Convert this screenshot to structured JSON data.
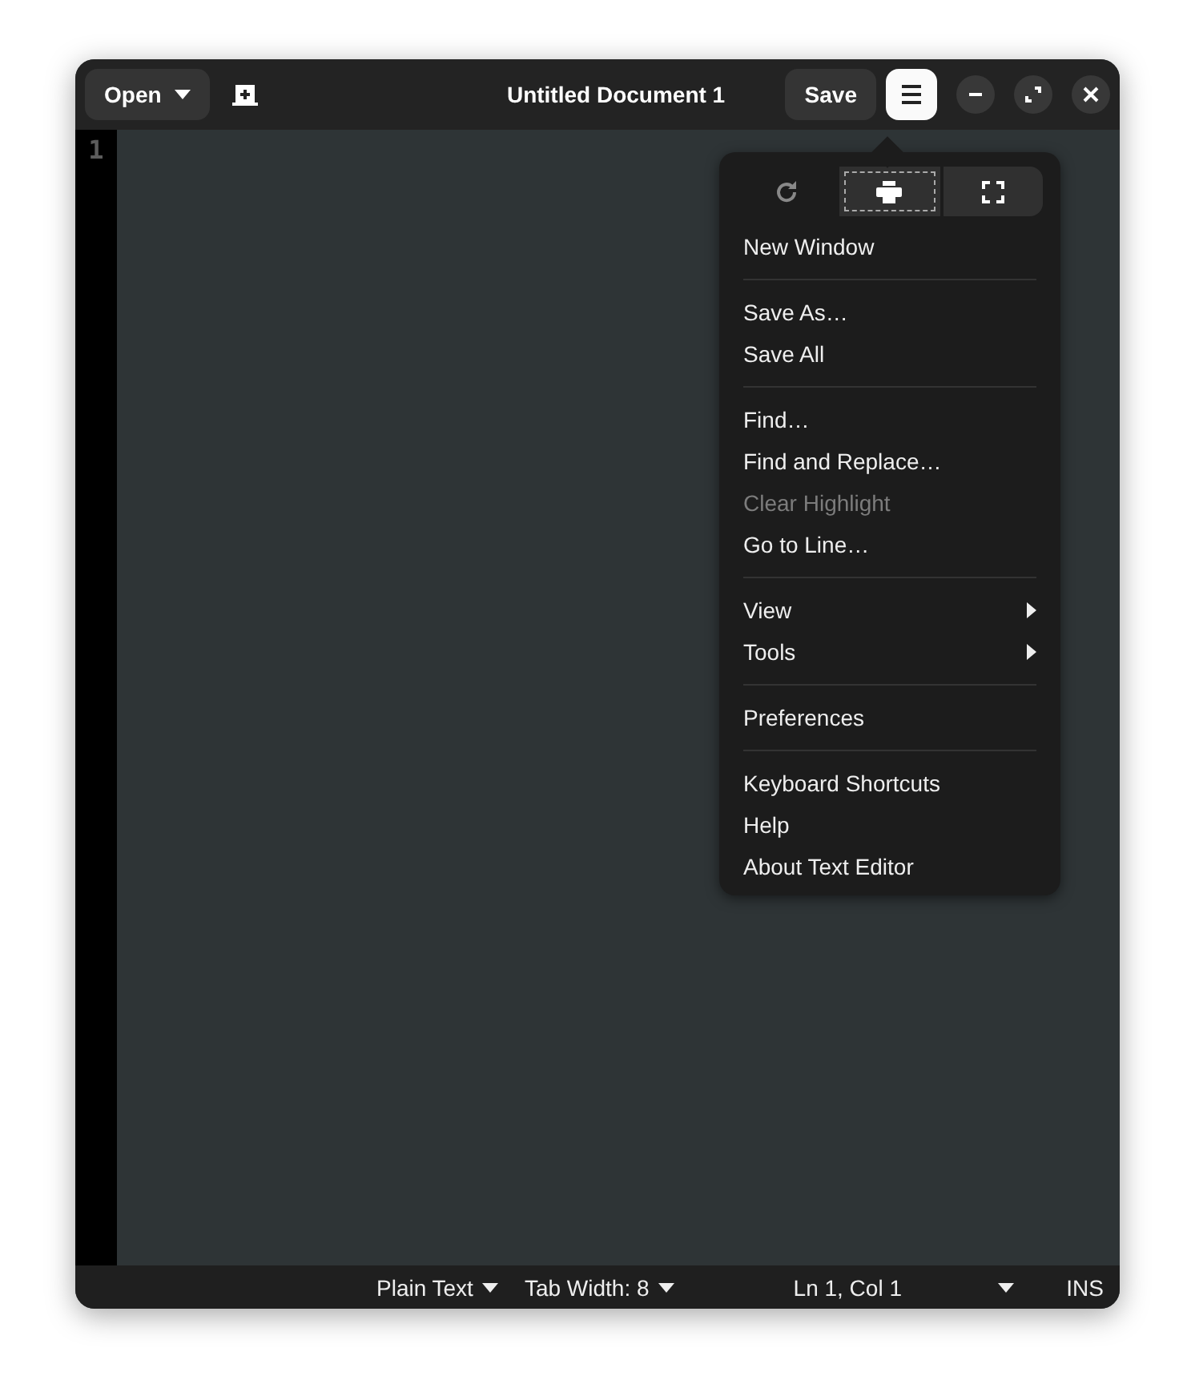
{
  "header": {
    "open_button": {
      "label": "Open"
    },
    "title": "Untitled Document 1",
    "save_button": {
      "label": "Save"
    },
    "menu_button": {
      "selected": true
    }
  },
  "editor": {
    "line_numbers": [
      "1"
    ]
  },
  "menu": {
    "icon_buttons": [
      {
        "kind": "reload",
        "disabled": true,
        "focused": false
      },
      {
        "kind": "print",
        "disabled": false,
        "focused": true
      },
      {
        "kind": "fullscreen",
        "disabled": false,
        "focused": false
      }
    ],
    "sections": [
      [
        {
          "label": "New Window",
          "disabled": false,
          "submenu": false
        }
      ],
      [
        {
          "label": "Save As…",
          "disabled": false,
          "submenu": false
        },
        {
          "label": "Save All",
          "disabled": false,
          "submenu": false
        }
      ],
      [
        {
          "label": "Find…",
          "disabled": false,
          "submenu": false
        },
        {
          "label": "Find and Replace…",
          "disabled": false,
          "submenu": false
        },
        {
          "label": "Clear Highlight",
          "disabled": true,
          "submenu": false
        },
        {
          "label": "Go to Line…",
          "disabled": false,
          "submenu": false
        }
      ],
      [
        {
          "label": "View",
          "disabled": false,
          "submenu": true
        },
        {
          "label": "Tools",
          "disabled": false,
          "submenu": true
        }
      ],
      [
        {
          "label": "Preferences",
          "disabled": false,
          "submenu": false
        }
      ],
      [
        {
          "label": "Keyboard Shortcuts",
          "disabled": false,
          "submenu": false
        },
        {
          "label": "Help",
          "disabled": false,
          "submenu": false
        },
        {
          "label": "About Text Editor",
          "disabled": false,
          "submenu": false
        }
      ]
    ]
  },
  "status_bar": {
    "language": "Plain Text",
    "tab_width": "Tab Width: 8",
    "position": "Ln 1, Col 1",
    "mode": "INS"
  }
}
